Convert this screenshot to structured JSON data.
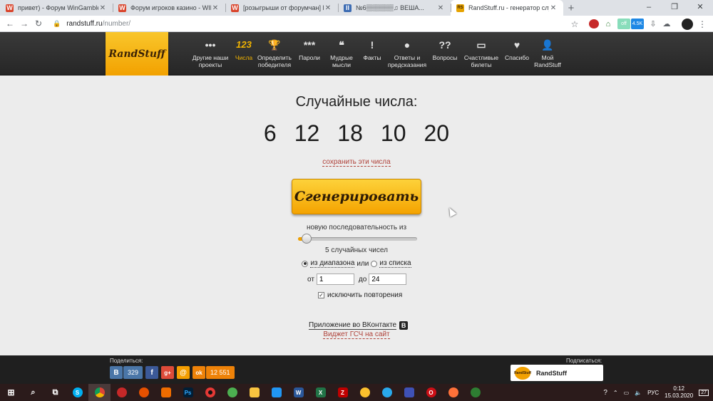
{
  "browser": {
    "tabs": [
      {
        "title": "привет) - Форум WinGamble",
        "favicon_letter": "W",
        "favicon_color": "#d9442b",
        "active": false
      },
      {
        "title": "Форум игроков казино - WING...",
        "favicon_letter": "W",
        "favicon_color": "#d9442b",
        "active": false
      },
      {
        "title": "[розыгрыши от форумчан] Роз...",
        "favicon_letter": "W",
        "favicon_color": "#d9442b",
        "active": false
      },
      {
        "title": "№6▒▒▒▒▒▒♫ ВЕША...",
        "favicon_letter": "II",
        "favicon_color": "#3d6cb3",
        "active": false
      },
      {
        "title": "RandStuff.ru - генератор случай...",
        "favicon_letter": "RS",
        "favicon_color": "#e6a300",
        "active": true
      }
    ],
    "new_tab_symbol": "+",
    "window_controls": [
      "–",
      "❐",
      "✕"
    ],
    "url_domain": "randstuff.ru",
    "url_path": "/number/",
    "extensions": {
      "badge_1": "off",
      "badge_2": "4.5K"
    }
  },
  "site": {
    "logo_text": "RandStuff",
    "nav": [
      {
        "icon": "•••",
        "icon_name": "dots-icon",
        "label": "Другие наши проекты",
        "active": false
      },
      {
        "icon": "123",
        "icon_name": "numbers-icon",
        "label": "Числа",
        "active": true
      },
      {
        "icon": "🏆",
        "icon_name": "trophy-icon",
        "label": "Определить победителя",
        "active": false
      },
      {
        "icon": "***",
        "icon_name": "asterisks-icon",
        "label": "Пароли",
        "active": false
      },
      {
        "icon": "❝",
        "icon_name": "quote-icon",
        "label": "Мудрые мысли",
        "active": false
      },
      {
        "icon": "!",
        "icon_name": "exclamation-icon",
        "label": "Факты",
        "active": false
      },
      {
        "icon": "●",
        "icon_name": "eight-ball-icon",
        "label": "Ответы и предсказания",
        "active": false
      },
      {
        "icon": "??",
        "icon_name": "question-icon",
        "label": "Вопросы",
        "active": false
      },
      {
        "icon": "▭",
        "icon_name": "ticket-icon",
        "label": "Счастливые билеты",
        "active": false
      },
      {
        "icon": "♥",
        "icon_name": "heart-icon",
        "label": "Спасибо",
        "active": false
      },
      {
        "icon": "👤",
        "icon_name": "user-icon",
        "label": "Мой RandStuff",
        "active": false
      }
    ]
  },
  "main": {
    "heading": "Случайные числа:",
    "numbers": [
      "6",
      "12",
      "18",
      "10",
      "20"
    ],
    "save_link": "сохранить эти числа",
    "generate_button": "Сгенерировать",
    "sequence_label": "новую последовательность из",
    "slider_fraction": 0.03,
    "count_label": "5 случайных чисел",
    "mode_range": "из диапазона",
    "mode_or": "или",
    "mode_list": "из списка",
    "from_label": "от",
    "from_value": "1",
    "to_label": "до",
    "to_value": "24",
    "exclude_repeats": "исключить повторения",
    "vk_app_link": "Приложение во ВКонтакте",
    "vk_badge": "B",
    "widget_link": "Виджет ГСЧ на сайт"
  },
  "footer": {
    "share_label": "Поделиться:",
    "vk_letter": "B",
    "vk_count": "329",
    "fb_letter": "f",
    "gplus_letter": "g+",
    "mail_letter": "@",
    "ok_letter": "ok",
    "ok_count": "12 551",
    "subscribe_label": "Подписаться:",
    "subscribe_name": "RandStuff",
    "subscribe_avatar": "RandStuff"
  },
  "taskbar": {
    "language": "РУС",
    "time": "0:12",
    "date": "15.03.2020",
    "notifications": "27"
  }
}
